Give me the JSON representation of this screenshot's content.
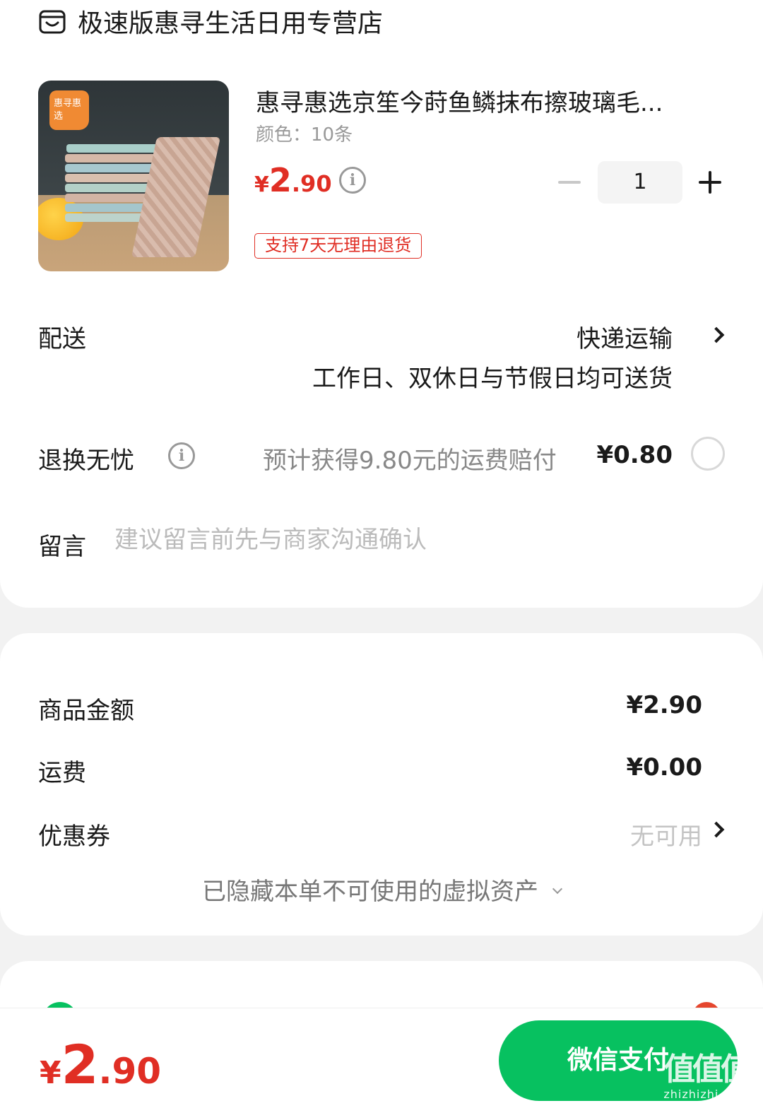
{
  "store": {
    "name": "极速版惠寻生活日用专营店",
    "icon": "store-icon"
  },
  "product": {
    "image_badge": "惠寻惠选",
    "title": "惠寻惠选京笙今莳鱼鳞抹布擦玻璃毛...",
    "spec": "颜色：10条",
    "price_currency": "¥",
    "price_int": "2",
    "price_dec": ".90",
    "quantity": "1",
    "tag": "支持7天无理由退货"
  },
  "shipping": {
    "label": "配送",
    "value": "快递运输",
    "sub": "工作日、双休日与节假日均可送货"
  },
  "return": {
    "label": "退换无忧",
    "desc": "预计获得9.80元的运费赔付",
    "price": "¥0.80"
  },
  "message": {
    "label": "留言",
    "placeholder": "建议留言前先与商家沟通确认"
  },
  "summary": {
    "goods_label": "商品金额",
    "goods_value": "¥2.90",
    "freight_label": "运费",
    "freight_value": "¥0.00",
    "coupon_label": "优惠券",
    "coupon_value": "无可用",
    "hidden_assets": "已隐藏本单不可使用的虚拟资产"
  },
  "footer": {
    "total_currency": "¥",
    "total_int": "2",
    "total_dec": ".90",
    "pay_label": "微信支付",
    "watermark": "值值值",
    "watermark_url": "zhizhizhi.com"
  },
  "colors": {
    "accent": "#e02e24",
    "wechat_green": "#07c160"
  }
}
